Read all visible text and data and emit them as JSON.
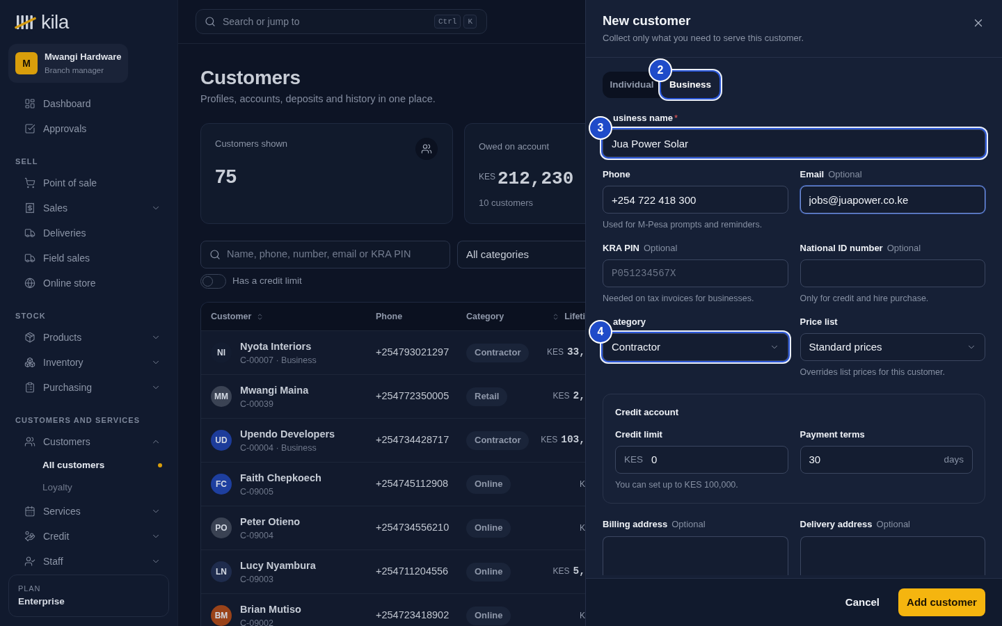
{
  "sidebar": {
    "logo": "kila",
    "account": {
      "initial": "M",
      "name": "Mwangi Hardware",
      "role": "Branch manager"
    },
    "sections": [
      {
        "items": [
          {
            "label": "Dashboard"
          },
          {
            "label": "Approvals"
          }
        ]
      },
      {
        "title": "SELL",
        "items": [
          {
            "label": "Point of sale"
          },
          {
            "label": "Sales",
            "expanded": false
          },
          {
            "label": "Deliveries"
          },
          {
            "label": "Field sales"
          },
          {
            "label": "Online store"
          }
        ]
      },
      {
        "title": "STOCK",
        "items": [
          {
            "label": "Products",
            "expanded": false
          },
          {
            "label": "Inventory",
            "expanded": false
          },
          {
            "label": "Purchasing",
            "expanded": false
          }
        ]
      },
      {
        "title": "CUSTOMERS AND SERVICES",
        "items": [
          {
            "label": "Customers",
            "expanded": true,
            "children": [
              {
                "label": "All customers",
                "selected": true
              },
              {
                "label": "Loyalty",
                "selected": false
              }
            ]
          },
          {
            "label": "Services",
            "expanded": false
          },
          {
            "label": "Credit",
            "expanded": false
          },
          {
            "label": "Staff",
            "expanded": false
          }
        ]
      }
    ],
    "plan": {
      "caption": "PLAN",
      "name": "Enterprise"
    }
  },
  "search": {
    "placeholder": "Search or jump to",
    "keys": [
      "Ctrl",
      "K"
    ]
  },
  "page": {
    "title": "Customers",
    "subtitle": "Profiles, accounts, deposits and history in one place."
  },
  "stats": [
    {
      "kind": "count",
      "label": "Customers shown",
      "value": "75"
    },
    {
      "kind": "amount",
      "label": "Owed on account",
      "currency": "KES",
      "value": "212,230",
      "note": "10 customers"
    }
  ],
  "filters": {
    "search_placeholder": "Name, phone, number, email or KRA PIN",
    "category": "All categories",
    "credit_limit": {
      "label": "Has a credit limit",
      "on": false
    }
  },
  "table": {
    "columns": [
      {
        "label": "Customer",
        "kind": "text",
        "sortable": true
      },
      {
        "label": "Phone",
        "kind": "text"
      },
      {
        "label": "Category",
        "kind": "text"
      },
      {
        "label": "Lifeti",
        "kind": "amount",
        "sortable": true
      }
    ],
    "rows": [
      {
        "initials": "NI",
        "color": "#131c30",
        "name": "Nyota Interiors",
        "subtitle": "C-00007 · Business",
        "phone": "+254793021297",
        "category": "Contractor",
        "lifetime": {
          "currency": "KES",
          "amount": "33,"
        }
      },
      {
        "initials": "MM",
        "color": "#3b4354",
        "name": "Mwangi Maina",
        "subtitle": "C-00039",
        "phone": "+254772350005",
        "category": "Retail",
        "lifetime": {
          "currency": "KES",
          "amount": "2,"
        }
      },
      {
        "initials": "UD",
        "color": "#1d3c9a",
        "name": "Upendo Developers",
        "subtitle": "C-00004 · Business",
        "phone": "+254734428717",
        "category": "Contractor",
        "lifetime": {
          "currency": "KES",
          "amount": "103,"
        }
      },
      {
        "initials": "FC",
        "color": "#1e3f9f",
        "name": "Faith Chepkoech",
        "subtitle": "C-09005",
        "phone": "+254745112908",
        "category": "Online",
        "lifetime": {
          "currency": "K"
        }
      },
      {
        "initials": "PO",
        "color": "#3a4253",
        "name": "Peter Otieno",
        "subtitle": "C-09004",
        "phone": "+254734556210",
        "category": "Online",
        "lifetime": {
          "currency": "K"
        }
      },
      {
        "initials": "LN",
        "color": "#1f2c4d",
        "name": "Lucy Nyambura",
        "subtitle": "C-09003",
        "phone": "+254711204556",
        "category": "Online",
        "lifetime": {
          "currency": "KES",
          "amount": "5,"
        }
      },
      {
        "initials": "BM",
        "color": "#9a4319",
        "name": "Brian Mutiso",
        "subtitle": "C-09002",
        "phone": "+254723418902",
        "category": "Online",
        "lifetime": {
          "currency": "K"
        }
      }
    ]
  },
  "drawer": {
    "title": "New customer",
    "subtitle": "Collect only what you need to serve this customer.",
    "customer_type": {
      "options": [
        {
          "label": "Individual",
          "selected": false
        },
        {
          "label": "Business",
          "selected": true,
          "marker": "2"
        }
      ]
    },
    "form": [
      {
        "fields": [
          {
            "kind": "text",
            "label": "usiness name",
            "required_mark": "*",
            "value": "Jua Power Solar",
            "marker": "3"
          }
        ]
      },
      {
        "fields": [
          {
            "kind": "text",
            "label": "Phone",
            "value": "+254 722 418 300",
            "hint": "Used for M-Pesa prompts and reminders."
          },
          {
            "kind": "text",
            "label": "Email",
            "optional": "Optional",
            "value": "jobs@juapower.co.ke",
            "focused": true
          }
        ]
      },
      {
        "fields": [
          {
            "kind": "code",
            "label": "KRA PIN",
            "optional": "Optional",
            "placeholder": "P051234567X",
            "hint": "Needed on tax invoices for businesses."
          },
          {
            "kind": "text",
            "label": "National ID number",
            "optional": "Optional",
            "hint": "Only for credit and hire purchase."
          }
        ]
      },
      {
        "fields": [
          {
            "kind": "select",
            "label": "ategory",
            "value": "Contractor",
            "marker": "4"
          },
          {
            "kind": "select",
            "label": "Price list",
            "value": "Standard prices",
            "hint": "Overrides list prices for this customer."
          }
        ]
      }
    ],
    "credit_account": {
      "title": "Credit account",
      "limit": {
        "label": "Credit limit",
        "prefix": "KES",
        "value": "0",
        "hint": "You can set up to KES 100,000."
      },
      "terms": {
        "label": "Payment terms",
        "value": "30",
        "suffix": "days"
      }
    },
    "addresses": [
      {
        "label": "Billing address",
        "optional": "Optional"
      },
      {
        "label": "Delivery address",
        "optional": "Optional"
      }
    ],
    "footer": {
      "cancel": "Cancel",
      "submit": "Add customer"
    }
  }
}
